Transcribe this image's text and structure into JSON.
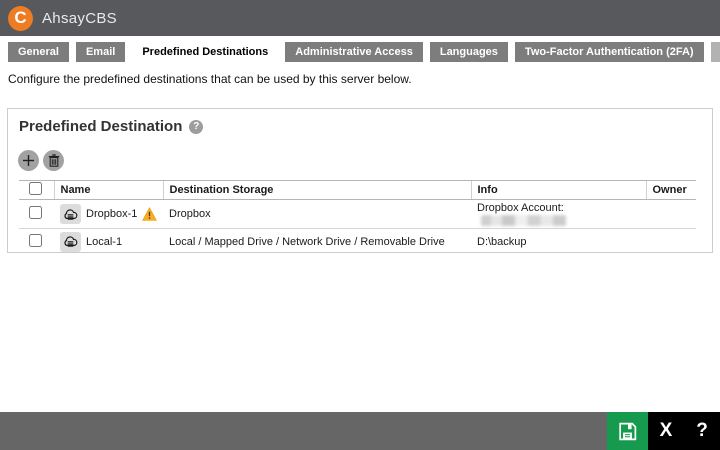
{
  "header": {
    "app_name": "AhsayCBS",
    "logo_letter": "C"
  },
  "tabs": [
    {
      "label": "General",
      "active": false
    },
    {
      "label": "Email",
      "active": false
    },
    {
      "label": "Predefined Destinations",
      "active": true
    },
    {
      "label": "Administrative Access",
      "active": false
    },
    {
      "label": "Languages",
      "active": false
    },
    {
      "label": "Two-Factor Authentication (2FA)",
      "active": false
    }
  ],
  "description": "Configure the predefined destinations that can be used by this server below.",
  "panel": {
    "title": "Predefined Destination",
    "help_icon": "?",
    "toolbar": {
      "add_icon": "plus",
      "delete_icon": "trash"
    },
    "table": {
      "columns": [
        "Name",
        "Destination Storage",
        "Info",
        "Owner"
      ],
      "rows": [
        {
          "name": "Dropbox-1",
          "icon": "cloud-storage",
          "warning": true,
          "storage": "Dropbox",
          "info": "Dropbox Account:",
          "info_redacted": true,
          "owner": ""
        },
        {
          "name": "Local-1",
          "icon": "cloud-storage",
          "warning": false,
          "storage": "Local / Mapped Drive / Network Drive / Removable Drive",
          "info": "D:\\backup",
          "info_redacted": false,
          "owner": ""
        }
      ]
    }
  },
  "footer": {
    "save_icon": "floppy-disk",
    "close_label": "X",
    "help_label": "?"
  },
  "colors": {
    "titlebar": "#58595C",
    "tab_gray": "#7D7D7D",
    "accent_orange": "#ED7C23",
    "footer_gray": "#666666",
    "save_green": "#169B4E",
    "warning_yellow": "#FBAF1C"
  }
}
